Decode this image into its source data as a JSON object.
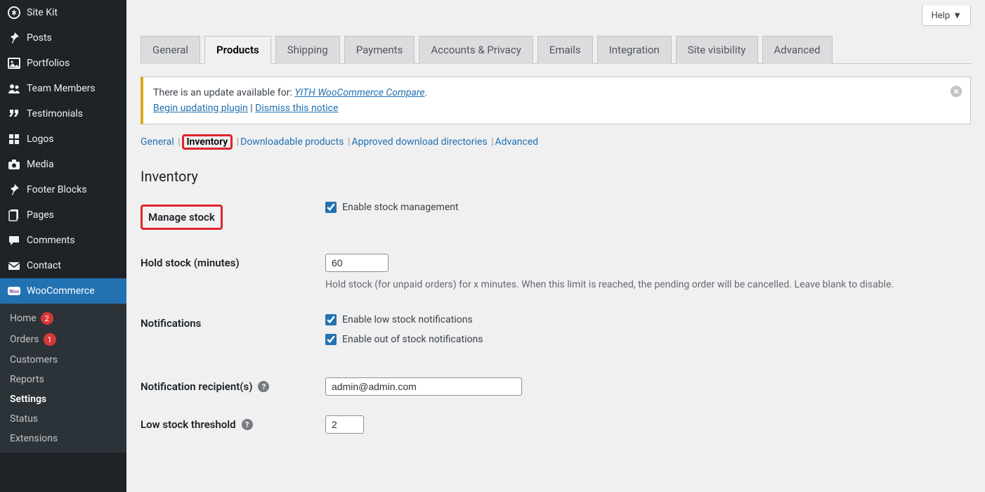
{
  "sidebar": {
    "items": [
      {
        "icon": "sitekit",
        "label": "Site Kit"
      },
      {
        "icon": "pin",
        "label": "Posts"
      },
      {
        "icon": "image",
        "label": "Portfolios"
      },
      {
        "icon": "users",
        "label": "Team Members"
      },
      {
        "icon": "quote",
        "label": "Testimonials"
      },
      {
        "icon": "grid",
        "label": "Logos"
      },
      {
        "icon": "camera",
        "label": "Media"
      },
      {
        "icon": "pin",
        "label": "Footer Blocks"
      },
      {
        "icon": "pages",
        "label": "Pages"
      },
      {
        "icon": "comment",
        "label": "Comments"
      },
      {
        "icon": "mail",
        "label": "Contact"
      }
    ],
    "woo_label": "WooCommerce",
    "woo_sub": [
      {
        "label": "Home",
        "badge": "2"
      },
      {
        "label": "Orders",
        "badge": "1"
      },
      {
        "label": "Customers"
      },
      {
        "label": "Reports"
      },
      {
        "label": "Settings",
        "current": true
      },
      {
        "label": "Status"
      },
      {
        "label": "Extensions"
      }
    ]
  },
  "help_label": "Help",
  "tabs": [
    "General",
    "Products",
    "Shipping",
    "Payments",
    "Accounts & Privacy",
    "Emails",
    "Integration",
    "Site visibility",
    "Advanced"
  ],
  "active_tab_index": 1,
  "notice": {
    "prefix": "There is an update available for: ",
    "plugin": "YITH WooCommerce Compare",
    "suffix": ".",
    "begin": "Begin updating plugin",
    "sep": " | ",
    "dismiss_link": "Dismiss this notice"
  },
  "subsubs": [
    {
      "label": "General"
    },
    {
      "label": "Inventory",
      "current": true,
      "highlight": true
    },
    {
      "label": "Downloadable products"
    },
    {
      "label": "Approved download directories"
    },
    {
      "label": "Advanced"
    }
  ],
  "section_title": "Inventory",
  "form": {
    "manage_stock": {
      "label": "Manage stock",
      "checkbox_label": "Enable stock management",
      "checked": true
    },
    "hold_stock": {
      "label": "Hold stock (minutes)",
      "value": "60",
      "desc": "Hold stock (for unpaid orders) for x minutes. When this limit is reached, the pending order will be cancelled. Leave blank to disable."
    },
    "notifications": {
      "label": "Notifications",
      "low": {
        "label": "Enable low stock notifications",
        "checked": true
      },
      "oos": {
        "label": "Enable out of stock notifications",
        "checked": true
      }
    },
    "recipients": {
      "label": "Notification recipient(s)",
      "value": "admin@admin.com"
    },
    "low_threshold": {
      "label": "Low stock threshold",
      "value": "2"
    }
  }
}
